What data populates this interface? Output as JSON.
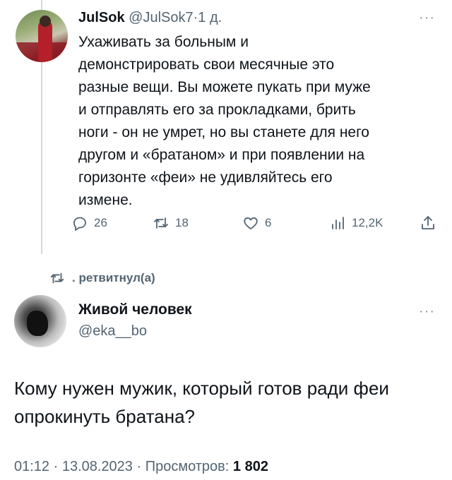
{
  "tweet1": {
    "name": "JulSok",
    "handle": "@JulSok7",
    "separator": "·",
    "time": "1 д.",
    "more": "···",
    "body_lines": [
      "Ухаживать за больным и",
      "демонстрировать свои месячные это",
      "разные вещи.  Вы можете пукать при муже",
      "и отправлять его за прокладками, брить",
      "ноги - он не умрет, но вы станете для него",
      "другом и «братаном» и при появлении на",
      "горизонте «феи» не удивляйтесь его",
      "измене."
    ],
    "actions": {
      "replies": "26",
      "retweets": "18",
      "likes": "6",
      "views": "12,2K"
    },
    "icons": [
      "reply-icon",
      "retweet-icon",
      "like-icon",
      "views-icon",
      "share-icon"
    ]
  },
  "retweet_label": ". ретвитнул(а)",
  "tweet2": {
    "name": "Живой человек",
    "handle": "@eka__bo",
    "more": "···",
    "body_lines": [
      "Кому нужен мужик, который готов ради феи",
      "опрокинуть братана?"
    ],
    "meta_prefix": "01:12 · 13.08.2023 · Просмотров: ",
    "views": "1 802"
  },
  "colors": {
    "text": "#0f1419",
    "secondary": "#536471",
    "thread_line": "#cfd9de"
  }
}
